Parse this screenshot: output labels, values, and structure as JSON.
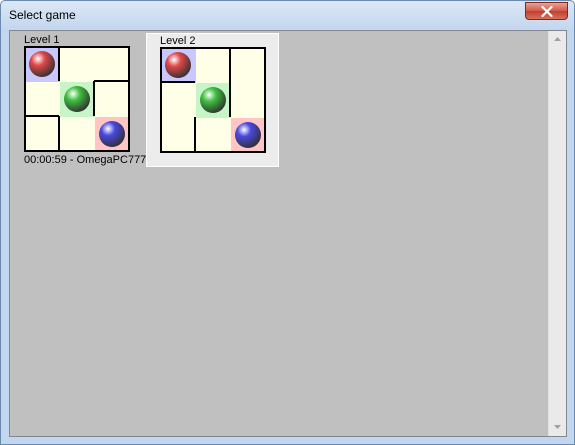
{
  "window": {
    "title": "Select game",
    "close_icon": "close-icon"
  },
  "colors": {
    "board_bg": "#ffffe8",
    "red_cell": "#ffc4c4",
    "green_cell": "#c8f5c8",
    "blue_cell": "#c8c8ff",
    "red_ball": "#e04848",
    "green_ball": "#40c040",
    "blue_ball": "#4848e0"
  },
  "levels": [
    {
      "label": "Level 1",
      "footer": "00:00:59 - OmegaPC777",
      "selected": false,
      "balls": [
        {
          "color": "red",
          "cell": [
            0,
            0
          ]
        },
        {
          "color": "green",
          "cell": [
            1,
            1
          ]
        },
        {
          "color": "blue",
          "cell": [
            2,
            2
          ]
        }
      ],
      "tinted_cells": [
        {
          "cell": [
            0,
            0
          ],
          "tint": "blue"
        },
        {
          "cell": [
            1,
            1
          ],
          "tint": "green"
        },
        {
          "cell": [
            2,
            2
          ],
          "tint": "red"
        }
      ]
    },
    {
      "label": "Level 2",
      "footer": "",
      "selected": true,
      "balls": [
        {
          "color": "red",
          "cell": [
            0,
            0
          ]
        },
        {
          "color": "green",
          "cell": [
            1,
            1
          ]
        },
        {
          "color": "blue",
          "cell": [
            2,
            2
          ]
        }
      ],
      "tinted_cells": [
        {
          "cell": [
            0,
            0
          ],
          "tint": "blue"
        },
        {
          "cell": [
            1,
            1
          ],
          "tint": "green"
        },
        {
          "cell": [
            2,
            2
          ],
          "tint": "red"
        }
      ]
    }
  ]
}
